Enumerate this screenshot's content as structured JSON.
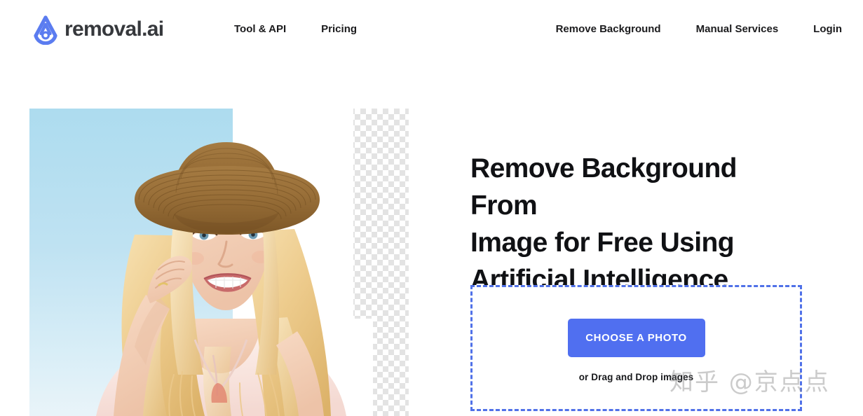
{
  "header": {
    "brand": {
      "logo_icon": "removal-ai-logo-icon",
      "wordmark": "removal.ai",
      "logo_color": "#5b7cf0"
    },
    "nav_left": [
      {
        "label": "Tool & API"
      },
      {
        "label": "Pricing"
      }
    ],
    "nav_right": [
      {
        "label": "Remove Background"
      },
      {
        "label": "Manual Services"
      },
      {
        "label": "Login"
      }
    ]
  },
  "hero": {
    "image": {
      "alt": "Smiling blonde woman wearing a straw hat with background removed",
      "sky_color_top": "#addcef",
      "sky_color_bottom": "#e9f4f9",
      "checker_color": "#e3e3e3"
    },
    "title_line1": "Remove Background From",
    "title_line2": "Image for Free Using",
    "title_line3": "Artificial Intelligence",
    "dropzone": {
      "button_label": "CHOOSE A PHOTO",
      "button_color": "#506ff0",
      "border_color": "#5071e8",
      "hint": "or Drag and Drop images"
    }
  },
  "watermark": {
    "text": "知乎 @京点点"
  }
}
